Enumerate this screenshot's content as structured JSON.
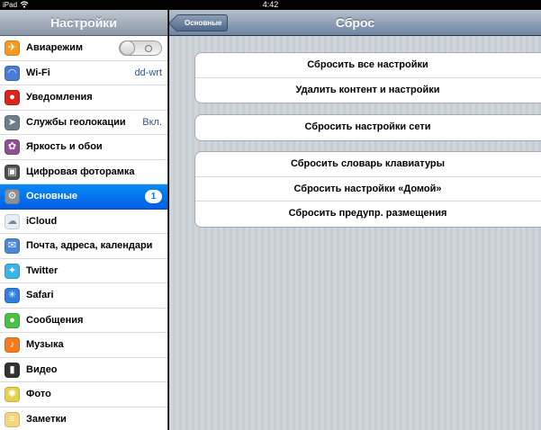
{
  "status_bar": {
    "device": "iPad",
    "time": "4:42"
  },
  "sidebar": {
    "title": "Настройки",
    "items": [
      {
        "label": "Авиарежим",
        "icon": "airplane-icon",
        "color": "#f29b1f",
        "glyph": "✈",
        "toggle": "off"
      },
      {
        "label": "Wi-Fi",
        "icon": "wifi-icon",
        "color": "#4a7ad6",
        "glyph": "◠",
        "value": "dd-wrt"
      },
      {
        "label": "Уведомления",
        "icon": "notifications-icon",
        "color": "#d9251d",
        "glyph": "●"
      },
      {
        "label": "Службы геолокации",
        "icon": "location-icon",
        "color": "#6f7c8a",
        "glyph": "➤",
        "value": "Вкл."
      },
      {
        "label": "Яркость и обои",
        "icon": "brightness-icon",
        "color": "#8e4f93",
        "glyph": "✿"
      },
      {
        "label": "Цифровая фоторамка",
        "icon": "photo-frame-icon",
        "color": "#4d4d4d",
        "glyph": "▣"
      },
      {
        "label": "Основные",
        "icon": "gear-icon",
        "color": "#8a9097",
        "glyph": "⚙",
        "badge": "1",
        "selected": true
      },
      {
        "label": "iCloud",
        "icon": "cloud-icon",
        "color": "#e8eef5",
        "glyph": "☁"
      },
      {
        "label": "Почта, адреса, календари",
        "icon": "mail-icon",
        "color": "#4c86d9",
        "glyph": "✉"
      },
      {
        "label": "Twitter",
        "icon": "twitter-icon",
        "color": "#3cb3e8",
        "glyph": "✦"
      },
      {
        "label": "Safari",
        "icon": "compass-icon",
        "color": "#2f7ee0",
        "glyph": "✳"
      },
      {
        "label": "Сообщения",
        "icon": "messages-icon",
        "color": "#48c146",
        "glyph": "●"
      },
      {
        "label": "Музыка",
        "icon": "music-icon",
        "color": "#f47b1f",
        "glyph": "♪"
      },
      {
        "label": "Видео",
        "icon": "video-icon",
        "color": "#333333",
        "glyph": "▮"
      },
      {
        "label": "Фото",
        "icon": "photos-icon",
        "color": "#e5d24a",
        "glyph": "✺"
      },
      {
        "label": "Заметки",
        "icon": "notes-icon",
        "color": "#f2d77b",
        "glyph": "≡"
      }
    ]
  },
  "navbar": {
    "title": "Сброс",
    "back_label": "Основные"
  },
  "groups": [
    {
      "rows": [
        "Сбросить все настройки",
        "Удалить контент и настройки"
      ]
    },
    {
      "rows": [
        "Сбросить настройки сети"
      ]
    },
    {
      "rows": [
        "Сбросить словарь клавиатуры",
        "Сбросить настройки «Домой»",
        "Сбросить предупр. размещения"
      ]
    }
  ]
}
